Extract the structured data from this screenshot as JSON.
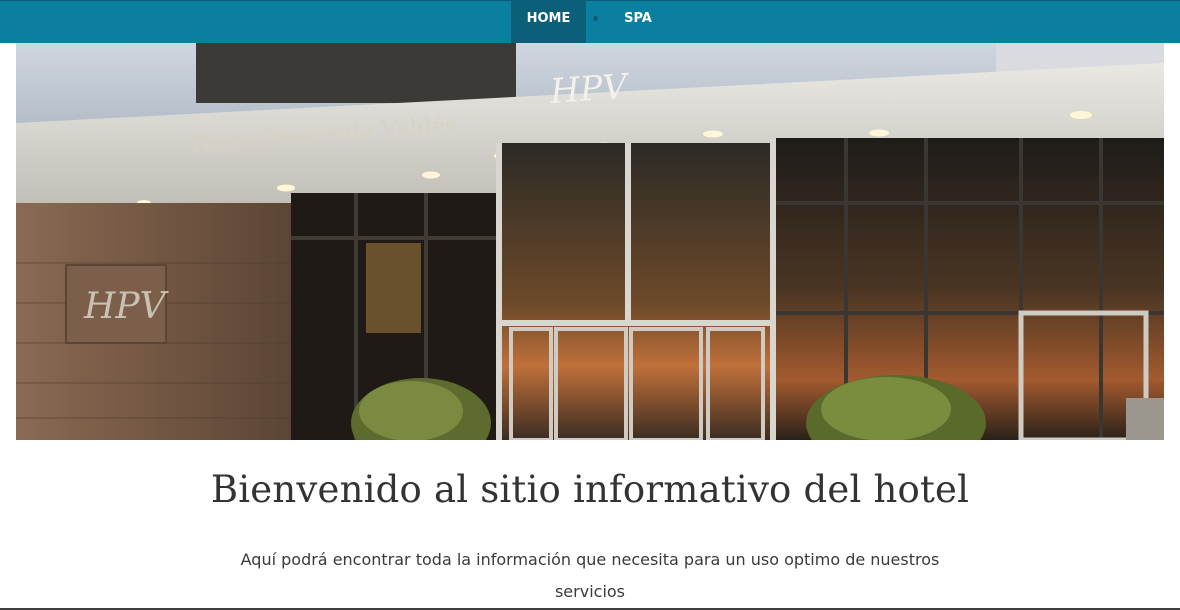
{
  "nav": {
    "items": [
      {
        "label": "HOME",
        "active": true
      },
      {
        "label": "SPA",
        "active": false
      }
    ]
  },
  "hero": {
    "hotel_sign": "Hotel Península Valdés",
    "logo_text": "HPV"
  },
  "main": {
    "title": "Bienvenido al sitio informativo del hotel",
    "description": "Aquí podrá encontrar toda la información que necesita para un uso optimo de nuestros servicios"
  },
  "colors": {
    "nav_bg": "#0a7fa0",
    "nav_active_bg": "#0b5f78",
    "title_text": "#333333"
  }
}
